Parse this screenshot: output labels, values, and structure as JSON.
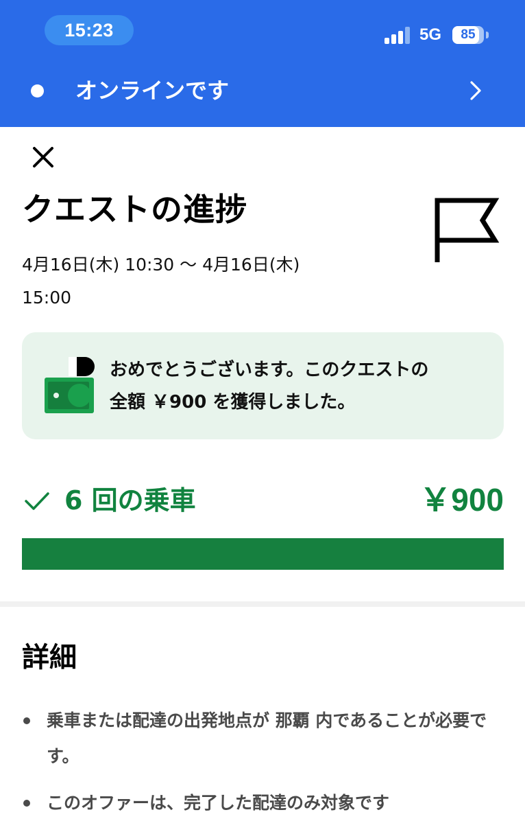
{
  "status_bar": {
    "time": "15:23",
    "network": "5G",
    "battery_level": "85",
    "battery_fraction": 0.85,
    "signal_bars_active": 3,
    "signal_bars_total": 4
  },
  "online_banner": {
    "label": "オンラインです",
    "chevron_icon": "chevron-right-icon"
  },
  "quest": {
    "close_icon": "close-icon",
    "title": "クエストの進捗",
    "dates_line1": "4月16日(木) 10:30 〜 4月16日(木)",
    "dates_line2": "15:00",
    "flag_icon": "flag-icon"
  },
  "congrats": {
    "icon": "money-icon",
    "line1": "おめでとうございます。このクエストの",
    "line2": "全額 ￥900 を獲得しました。"
  },
  "progress": {
    "check_icon": "check-icon",
    "label": "6 回の乗車",
    "amount": "￥900",
    "fraction": 1.0
  },
  "details": {
    "title": "詳細",
    "items": [
      "乗車または配達の出発地点が 那覇 内であることが必要です。",
      "このオファーは、完了した配達のみ対象です"
    ]
  },
  "colors": {
    "header_blue": "#2a6be8",
    "accent_green": "#11833f",
    "card_background": "#e8f4ec",
    "progress_fill": "#16803f"
  }
}
